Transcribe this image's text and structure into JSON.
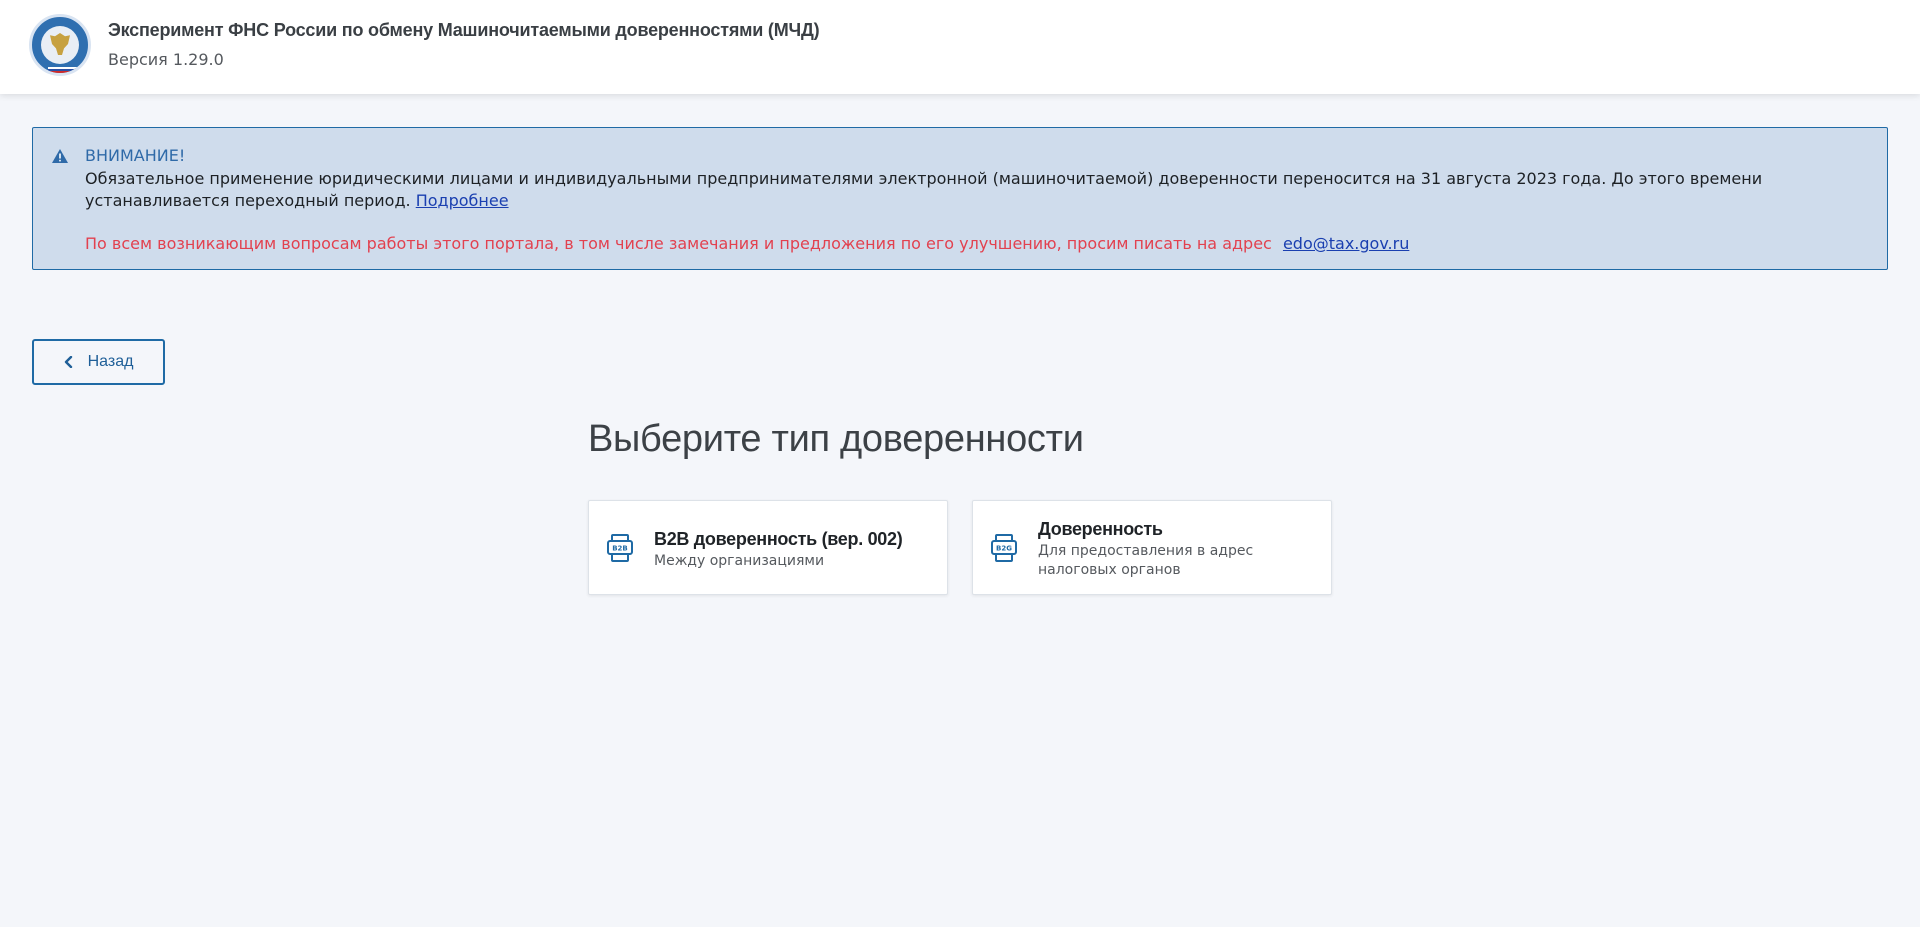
{
  "header": {
    "title": "Эксперимент ФНС России по обмену Машиночитаемыми доверенностями (МЧД)",
    "version": "Версия 1.29.0",
    "logo_icon": "fns-emblem-icon"
  },
  "alert": {
    "heading": "ВНИМАНИЕ!",
    "text": "Обязательное применение юридическими лицами и индивидуальными предпринимателями электронной (машиночитаемой) доверенности переносится на 31 августа 2023 года. До этого времени устанавливается переходный период.",
    "link_label": "Подробнее",
    "contact_text": "По всем возникающим вопросам работы этого портала, в том числе замечания и предложения по его улучшению, просим писать на адрес",
    "contact_email": "edo@tax.gov.ru",
    "colors": {
      "background": "#cfdcec",
      "border": "#1f6aa5",
      "heading": "#2f6aa8",
      "contact": "#e2414f",
      "link": "#1a3fb0"
    }
  },
  "back_button": {
    "label": "Назад",
    "icon": "chevron-left-icon"
  },
  "main": {
    "title": "Выберите тип доверенности",
    "cards": [
      {
        "icon": "b2b-printer-icon",
        "icon_text": "B2B",
        "title": "B2B доверенность (вер. 002)",
        "subtitle": "Между организациями"
      },
      {
        "icon": "b2g-printer-icon",
        "icon_text": "B2G",
        "title": "Доверенность",
        "subtitle": "Для предоставления в адрес налоговых органов"
      }
    ]
  },
  "colors": {
    "page_background": "#f4f6fa",
    "accent": "#1f6aa5"
  }
}
